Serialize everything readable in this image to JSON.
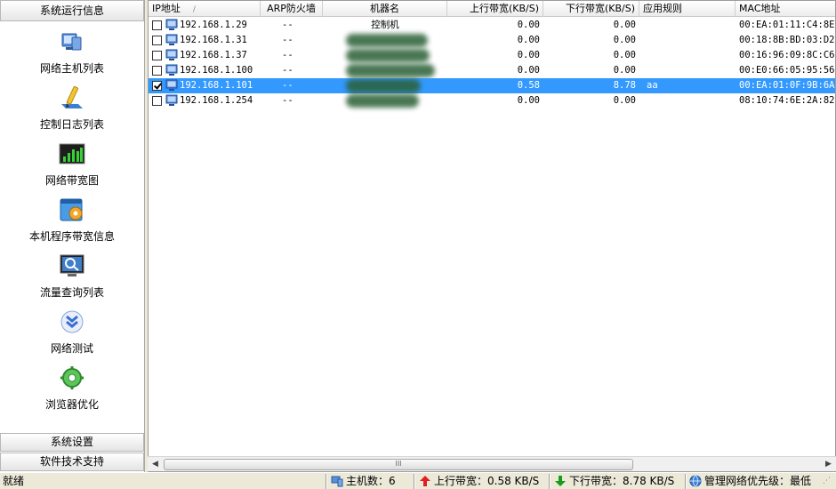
{
  "left_panel": {
    "header": "系统运行信息",
    "items": [
      {
        "label": "网络主机列表",
        "icon": "network-host-icon"
      },
      {
        "label": "控制日志列表",
        "icon": "control-log-icon"
      },
      {
        "label": "网络带宽图",
        "icon": "bandwidth-chart-icon"
      },
      {
        "label": "本机程序带宽信息",
        "icon": "program-bandwidth-icon"
      },
      {
        "label": "流量查询列表",
        "icon": "traffic-query-icon"
      },
      {
        "label": "网络测试",
        "icon": "network-test-icon"
      },
      {
        "label": "浏览器优化",
        "icon": "browser-optimize-icon"
      }
    ],
    "system_settings": "系统设置",
    "tech_support": "软件技术支持"
  },
  "table": {
    "columns": {
      "ip": "IP地址",
      "arp": "ARP防火墙",
      "name": "机器名",
      "up": "上行带宽(KB/S)",
      "down": "下行带宽(KB/S)",
      "rule": "应用规则",
      "mac": "MAC地址"
    },
    "sort_indicator": "/",
    "rows": [
      {
        "checked": false,
        "ip": "192.168.1.29",
        "arp": "--",
        "name": "控制机",
        "name_blurred": false,
        "up": "0.00",
        "down": "0.00",
        "rule": "",
        "mac": "00:EA:01:11:C4:8E",
        "selected": false
      },
      {
        "checked": false,
        "ip": "192.168.1.31",
        "arp": "--",
        "name": "",
        "name_blurred": true,
        "up": "0.00",
        "down": "0.00",
        "rule": "",
        "mac": "00:18:8B:BD:03:D2",
        "selected": false
      },
      {
        "checked": false,
        "ip": "192.168.1.37",
        "arp": "--",
        "name": "",
        "name_blurred": true,
        "up": "0.00",
        "down": "0.00",
        "rule": "",
        "mac": "00:16:96:09:8C:C6",
        "selected": false
      },
      {
        "checked": false,
        "ip": "192.168.1.100",
        "arp": "--",
        "name": "",
        "name_blurred": true,
        "up": "0.00",
        "down": "0.00",
        "rule": "",
        "mac": "00:E0:66:05:95:56",
        "selected": false
      },
      {
        "checked": true,
        "ip": "192.168.1.101",
        "arp": "--",
        "name": "",
        "name_blurred": true,
        "up": "0.58",
        "down": "8.78",
        "rule": "aa",
        "mac": "00:EA:01:0F:9B:6A",
        "selected": true
      },
      {
        "checked": false,
        "ip": "192.168.1.254",
        "arp": "--",
        "name": "",
        "name_blurred": true,
        "up": "0.00",
        "down": "0.00",
        "rule": "",
        "mac": "08:10:74:6E:2A:82",
        "selected": false
      }
    ]
  },
  "scrollbar": {
    "thumb_grip": "III"
  },
  "status_bar": {
    "ready": "就绪",
    "host_count": "主机数：6",
    "upload": "上行带宽：0.58 KB/S",
    "download": "下行带宽：8.78 KB/S",
    "priority": "管理网络优先级：最低"
  },
  "colors": {
    "selection": "#3399ff",
    "upload_arrow": "#e02020",
    "download_arrow": "#1a9a1a"
  }
}
